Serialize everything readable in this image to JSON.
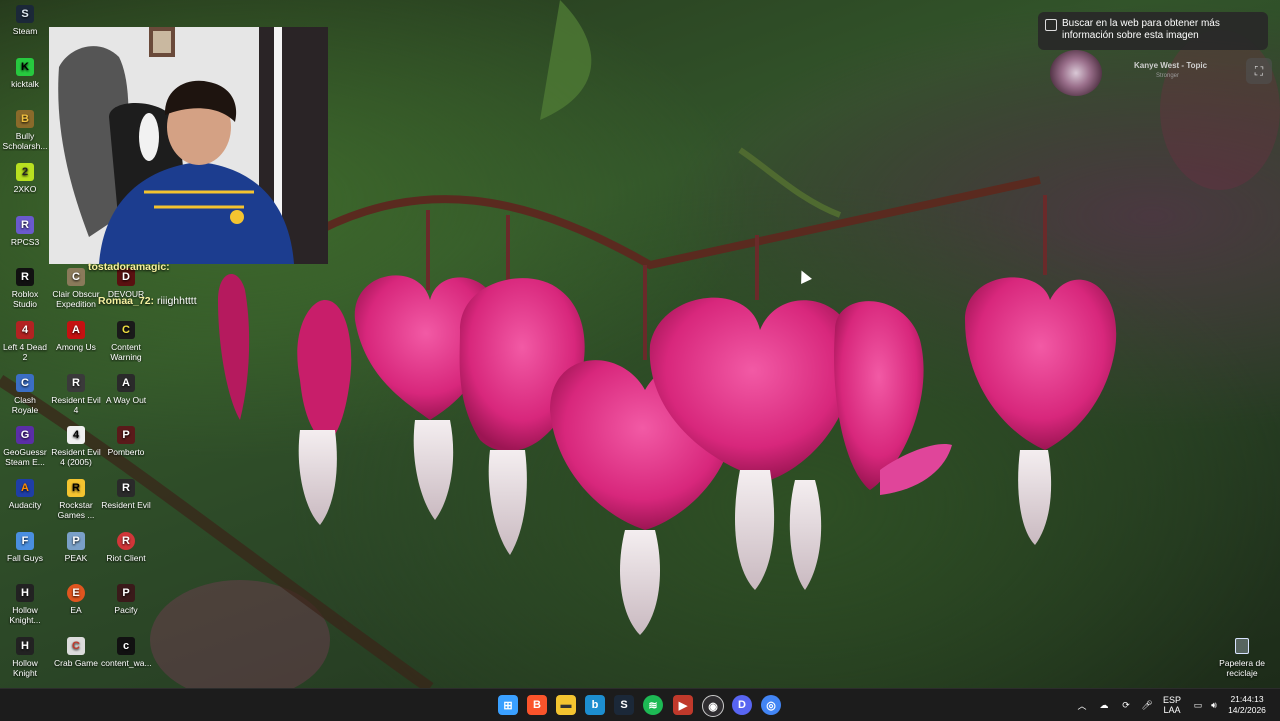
{
  "desktop": {
    "icons": [
      {
        "label": "Steam",
        "icon": "steam-icon",
        "color": "#1b2838",
        "glyph": "S"
      },
      {
        "label": "kicktalk",
        "icon": "kicktalk-icon",
        "color": "#27c93f",
        "glyph": "K"
      },
      {
        "label": "Bully Scholarsh...",
        "icon": "bully-icon",
        "color": "#8a6a2a",
        "glyph": "B"
      },
      {
        "label": "2XKO",
        "icon": "2xko-icon",
        "color": "#b8e020",
        "glyph": "2"
      },
      {
        "label": "RPCS3",
        "icon": "rpcs3-icon",
        "color": "#6a5acd",
        "glyph": "R"
      },
      {
        "label": "Roblox Studio",
        "icon": "roblox-studio-icon",
        "color": "#111111",
        "glyph": "R"
      },
      {
        "label": "Left 4 Dead 2",
        "icon": "left4dead2-icon",
        "color": "#b22222",
        "glyph": "4"
      },
      {
        "label": "Clash Royale",
        "icon": "clash-royale-icon",
        "color": "#3b6ec4",
        "glyph": "C"
      },
      {
        "label": "GeoGuessr Steam E...",
        "icon": "geoguessr-icon",
        "color": "#5a2ea6",
        "glyph": "G"
      },
      {
        "label": "Audacity",
        "icon": "audacity-icon",
        "color": "#1f3ea6",
        "glyph": "A"
      },
      {
        "label": "Fall Guys",
        "icon": "fall-guys-icon",
        "color": "#4a8fe0",
        "glyph": "F"
      },
      {
        "label": "Hollow Knight...",
        "icon": "hollow-knight-icon",
        "color": "#222222",
        "glyph": "H"
      },
      {
        "label": "Hollow Knight",
        "icon": "hollow-knight-icon",
        "color": "#222222",
        "glyph": "H"
      },
      {
        "label": "Clair Obscur Expedition 33",
        "icon": "clair-obscur-icon",
        "color": "#8a7a5a",
        "glyph": "C"
      },
      {
        "label": "Among Us",
        "icon": "among-us-icon",
        "color": "#c51111",
        "glyph": "A"
      },
      {
        "label": "Resident Evil 4",
        "icon": "resident-evil-4-icon",
        "color": "#3a3a3a",
        "glyph": "R"
      },
      {
        "label": "Resident Evil 4 (2005)",
        "icon": "resident-evil-4-2005-icon",
        "color": "#f0f0f0",
        "glyph": "4"
      },
      {
        "label": "Rockstar Games ...",
        "icon": "rockstar-icon",
        "color": "#f4c430",
        "glyph": "R"
      },
      {
        "label": "PEAK",
        "icon": "peak-icon",
        "color": "#7aa0c8",
        "glyph": "P"
      },
      {
        "label": "EA",
        "icon": "ea-icon",
        "color": "#e0551f",
        "glyph": "E"
      },
      {
        "label": "Crab Game",
        "icon": "crab-game-icon",
        "color": "#dcdcdc",
        "glyph": "C"
      },
      {
        "label": "DEVOUR",
        "icon": "devour-icon",
        "color": "#5a1010",
        "glyph": "D"
      },
      {
        "label": "Content Warning",
        "icon": "content-warning-icon",
        "color": "#1a1a1a",
        "glyph": "C"
      },
      {
        "label": "A Way Out",
        "icon": "a-way-out-icon",
        "color": "#2a2a2a",
        "glyph": "A"
      },
      {
        "label": "Pomberto",
        "icon": "pomberto-icon",
        "color": "#5a1a1a",
        "glyph": "P"
      },
      {
        "label": "Resident Evil",
        "icon": "resident-evil-icon",
        "color": "#2a2a2a",
        "glyph": "R"
      },
      {
        "label": "Riot Client",
        "icon": "riot-client-icon",
        "color": "#d13639",
        "glyph": "R"
      },
      {
        "label": "Pacify",
        "icon": "pacify-icon",
        "color": "#3a1a1a",
        "glyph": "P"
      },
      {
        "label": "content_wa...",
        "icon": "content-warning-file-icon",
        "color": "#111111",
        "glyph": "c"
      }
    ],
    "recycle_bin": "Papelera de reciclaje"
  },
  "chat": {
    "line1_user": "tostadoramagic:",
    "line2_user": "Romaa_72:",
    "line2_msg": "riiighhtttt"
  },
  "lens": {
    "tooltip": "Buscar en la web para obtener más información sobre esta imagen",
    "artist": "Kanye West - Topic",
    "song": "Stronger"
  },
  "taskbar": {
    "apps": [
      {
        "name": "windows-start",
        "color": "#3aa0ff"
      },
      {
        "name": "brave",
        "color": "#fb542b"
      },
      {
        "name": "file-explorer",
        "color": "#f4c430"
      },
      {
        "name": "bing",
        "color": "#1d8ecf"
      },
      {
        "name": "steam",
        "color": "#1b2838"
      },
      {
        "name": "spotify",
        "color": "#1db954"
      },
      {
        "name": "video-app",
        "color": "#c0392b"
      },
      {
        "name": "obs",
        "color": "#302e31"
      },
      {
        "name": "discord",
        "color": "#5865f2"
      },
      {
        "name": "chrome",
        "color": "#4285f4"
      }
    ],
    "lang_top": "ESP",
    "lang_bottom": "LAA",
    "time": "21:44:13",
    "date": "14/2/2026"
  }
}
